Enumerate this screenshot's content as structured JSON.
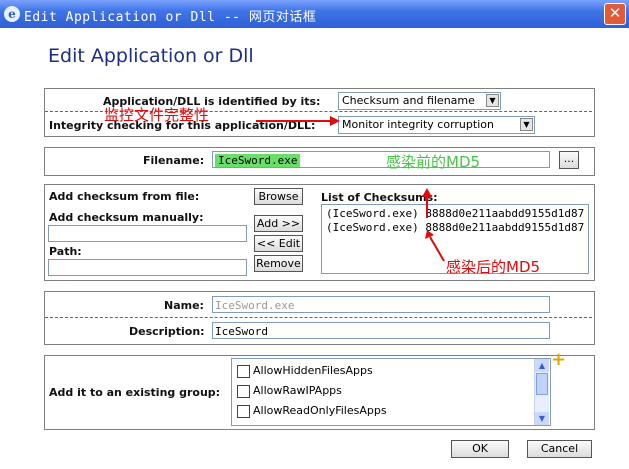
{
  "window": {
    "title": "Edit Application or Dll -- 网页对话框",
    "close_glyph": "✕",
    "ie_glyph": "e"
  },
  "heading": "Edit Application or Dll",
  "identification": {
    "identified_label": "Application/DLL is identified by its:",
    "identified_value": "Checksum and filename",
    "integrity_label": "Integrity checking for this application/DLL:",
    "integrity_value": "Monitor integrity corruption"
  },
  "filename": {
    "label": "Filename:",
    "value": "IceSword.exe",
    "browse_glyph": "..."
  },
  "checksum": {
    "from_file_label": "Add checksum from file:",
    "browse_label": "Browse",
    "manual_label": "Add checksum manually:",
    "path_label": "Path:",
    "add_label": "Add >>",
    "edit_label": "<< Edit",
    "remove_label": "Remove",
    "list_label": "List of Checksums:",
    "items": [
      "(IceSword.exe) 8888d0e211aabdd9155d1d87",
      "(IceSword.exe) 8888d0e211aabdd9155d1d87"
    ]
  },
  "details": {
    "name_label": "Name:",
    "name_value": "IceSword.exe",
    "description_label": "Description:",
    "description_value": "IceSword"
  },
  "group": {
    "label": "Add it to an existing group:",
    "items": [
      "AllowHiddenFilesApps",
      "AllowRawIPApps",
      "AllowReadOnlyFilesApps"
    ],
    "add_glyph": "+"
  },
  "footer": {
    "ok_label": "OK",
    "cancel_label": "Cancel"
  },
  "annotations": {
    "monitor_text": "监控文件完整性",
    "before_text": "感染前的MD5",
    "after_text": "感染后的MD5",
    "red": "#e10b0b",
    "green": "#49c549"
  }
}
